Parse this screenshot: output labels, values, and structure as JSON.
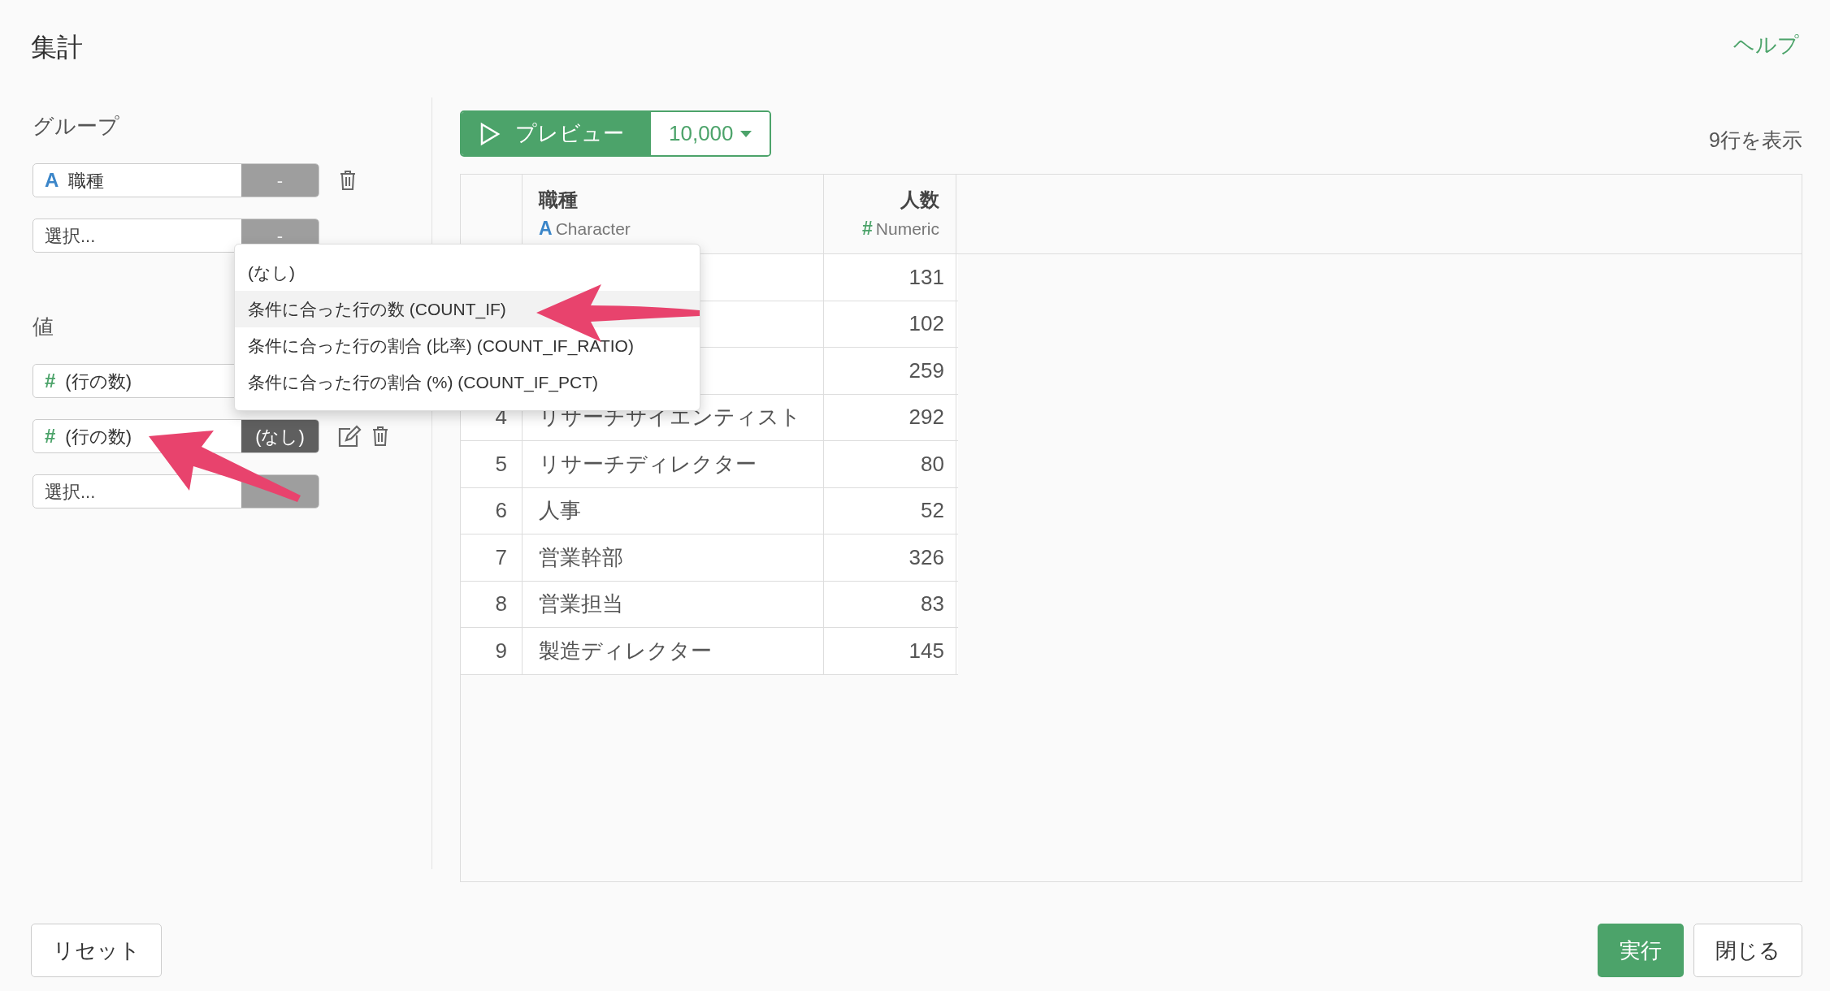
{
  "title": "集計",
  "help_link": "ヘルプ",
  "group": {
    "label": "グループ",
    "fields": [
      {
        "kind": "character",
        "mark": "A",
        "value": "職種",
        "button": "-",
        "open": false,
        "deletable": true
      },
      {
        "kind": "select",
        "placeholder": "選択...",
        "button": "-",
        "open": false
      }
    ]
  },
  "values": {
    "label": "値",
    "fields": [
      {
        "kind": "numeric",
        "mark": "#",
        "value": "(行の数)"
      },
      {
        "kind": "numeric",
        "mark": "#",
        "value": "(行の数)",
        "button": "(なし)",
        "open": true,
        "editable": true,
        "deletable": true
      },
      {
        "kind": "select",
        "placeholder": "選択...",
        "open": false
      }
    ]
  },
  "dropdown": {
    "items": [
      {
        "label": "(なし)",
        "selected": false
      },
      {
        "label": "条件に合った行の数 (COUNT_IF)",
        "selected": true
      },
      {
        "label": "条件に合った行の割合 (比率) (COUNT_IF_RATIO)",
        "selected": false
      },
      {
        "label": "条件に合った行の割合 (%) (COUNT_IF_PCT)",
        "selected": false
      }
    ]
  },
  "preview": {
    "label": "プレビュー",
    "limit": "10,000"
  },
  "row_count": "9行を表示",
  "table": {
    "columns": [
      {
        "kind": "character",
        "name": "職種",
        "mark": "A",
        "type": "Character"
      },
      {
        "kind": "numeric",
        "name": "人数",
        "mark": "#",
        "type": "Numeric"
      }
    ],
    "rows": [
      {
        "count": "131"
      },
      {
        "count": "102"
      },
      {
        "count": "259"
      },
      {
        "index": "4",
        "job": "リサーチサイエンティスト",
        "count": "292"
      },
      {
        "index": "5",
        "job": "リサーチディレクター",
        "count": "80"
      },
      {
        "index": "6",
        "job": "人事",
        "count": "52"
      },
      {
        "index": "7",
        "job": "営業幹部",
        "count": "326"
      },
      {
        "index": "8",
        "job": "営業担当",
        "count": "83"
      },
      {
        "index": "9",
        "job": "製造ディレクター",
        "count": "145"
      }
    ]
  },
  "footer": {
    "reset": "リセット",
    "run": "実行",
    "close": "閉じる"
  }
}
